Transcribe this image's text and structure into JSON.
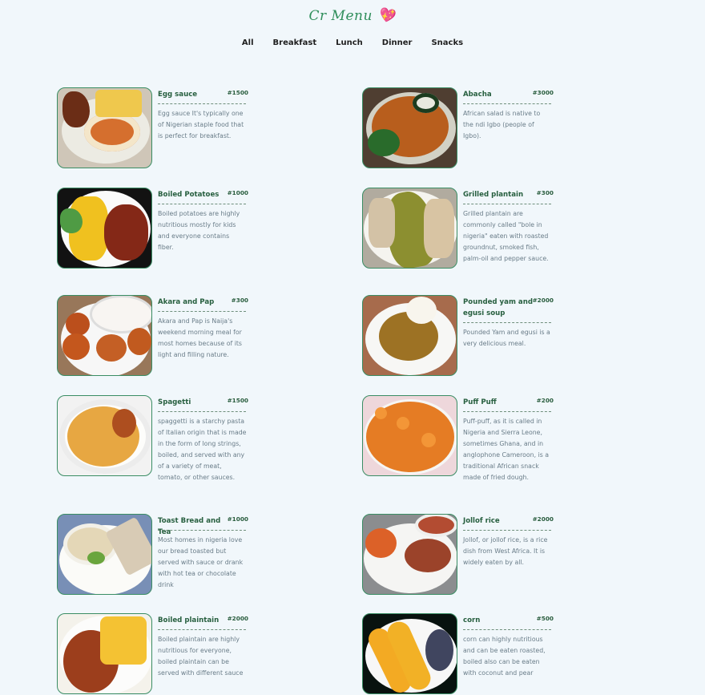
{
  "brand": {
    "name": "Cr Menu",
    "heart": "💖"
  },
  "tabs": [
    "All",
    "Breakfast",
    "Lunch",
    "Dinner",
    "Snacks"
  ],
  "items": [
    {
      "name": "Egg sauce",
      "price": "#1500",
      "description": "Egg sauce It's typically one of Nigerian staple food that is perfect for breakfast."
    },
    {
      "name": "Abacha",
      "price": "#3000",
      "description": "African salad is native to the ndi Igbo (people of Igbo)."
    },
    {
      "name": "Boiled Potatoes",
      "price": "#1000",
      "description": "Boiled potatoes are highly nutritious mostly for kids and everyone contains fiber."
    },
    {
      "name": "Grilled plantain",
      "price": "#300",
      "description": "Grilled plantain are commonly called \"bole in nigeria\" eaten with roasted groundnut, smoked fish, palm-oil and pepper sauce."
    },
    {
      "name": "Akara and Pap",
      "price": "#300",
      "description": "Akara and Pap is Naija's weekend morning meal for most homes because of its light and filling nature."
    },
    {
      "name": "Pounded yam and egusi soup",
      "price": "#2000",
      "description": "Pounded Yam and egusi is a very delicious meal."
    },
    {
      "name": "Spagetti",
      "price": "#1500",
      "description": "spaggetti is a starchy pasta of Italian origin that is made in the form of long strings, boiled, and served with any of a variety of meat, tomato, or other sauces."
    },
    {
      "name": "Puff Puff",
      "price": "#200",
      "description": "Puff-puff, as it is called in Nigeria and Sierra Leone, sometimes Ghana, and in anglophone Cameroon, is a traditional African snack made of fried dough."
    },
    {
      "name": "Toast Bread and Tea",
      "price": "#1000",
      "description": "Most homes in nigeria love our bread toasted but served with sauce or drank with hot tea or chocolate drink"
    },
    {
      "name": "Jollof rice",
      "price": "#2000",
      "description": "Jollof, or jollof rice, is a rice dish from West Africa. It is widely eaten by all."
    },
    {
      "name": "Boiled plaintain",
      "price": "#2000",
      "description": "Boiled plaintain are highly nutritious for everyone, boiled plaintain can be served with different sauce"
    },
    {
      "name": "corn",
      "price": "#500",
      "description": "corn can highly nutritious and can be eaten roasted, boiled also can be eaten with coconut and pear"
    }
  ],
  "icons": [
    "heart-icon",
    "food-photo"
  ],
  "colors": {
    "background": "#f1f7fb",
    "accent": "#2f8e5b",
    "text_muted": "#697c88"
  }
}
